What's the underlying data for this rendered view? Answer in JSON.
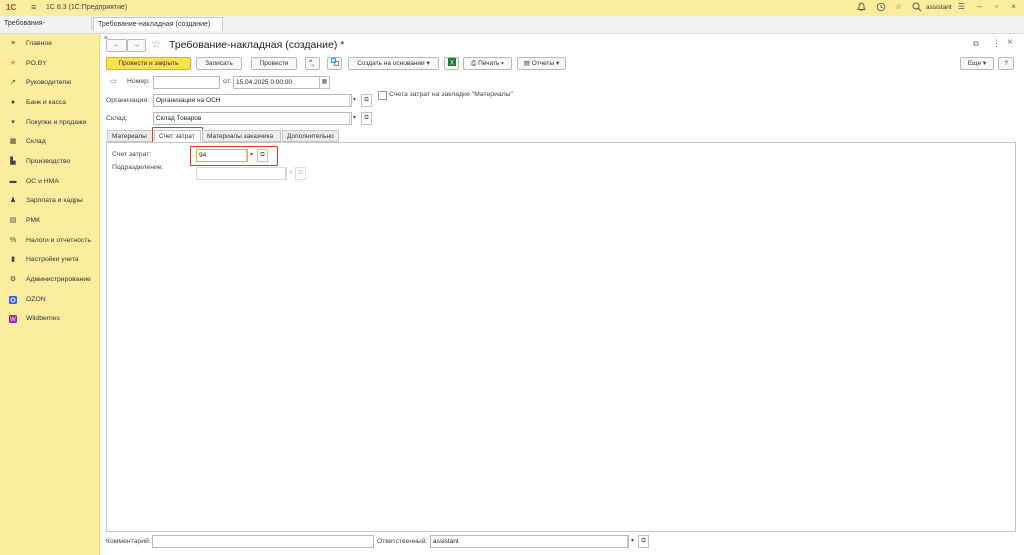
{
  "titlebar": {
    "logo": "1С",
    "app_title": "1С 8.3  (1С:Предприятие)",
    "user": "assistant",
    "menu_icon": "hamburger-icon",
    "icons": [
      "bell-icon",
      "history-icon",
      "star-icon",
      "search-icon",
      "settings-lines-icon",
      "minimize-icon",
      "restore-icon",
      "close-icon"
    ]
  },
  "tabs": [
    {
      "label": "Требования-накладные",
      "close": "×"
    },
    {
      "label": "Требование-накладная (создание) *",
      "close": "×"
    }
  ],
  "sidebar": {
    "items": [
      {
        "label": "Главное",
        "icon": "menu-lines-icon"
      },
      {
        "label": "PO.BY",
        "icon": "sun-icon"
      },
      {
        "label": "Руководителю",
        "icon": "trend-icon"
      },
      {
        "label": "Банк и касса",
        "icon": "bank-icon"
      },
      {
        "label": "Покупки и продажи",
        "icon": "cart-icon"
      },
      {
        "label": "Склад",
        "icon": "warehouse-icon"
      },
      {
        "label": "Производство",
        "icon": "factory-icon"
      },
      {
        "label": "ОС и НМА",
        "icon": "car-icon"
      },
      {
        "label": "Зарплата и кадры",
        "icon": "person-icon"
      },
      {
        "label": "РМК",
        "icon": "register-icon"
      },
      {
        "label": "Налоги и отчетность",
        "icon": "tax-icon"
      },
      {
        "label": "Настройки учета",
        "icon": "book-icon"
      },
      {
        "label": "Администрирование",
        "icon": "gear-icon"
      },
      {
        "label": "OZON",
        "icon": "ozon-icon"
      },
      {
        "label": "Wildberries",
        "icon": "wildberries-icon"
      }
    ]
  },
  "form": {
    "title": "Требование-накладная (создание) *",
    "nav_back": "←",
    "nav_forward": "→",
    "star": "☆",
    "link_icon": "⧉",
    "more_icon": "⋮",
    "close_icon": "×",
    "toolbar": {
      "post_close": "Провести и закрыть",
      "save": "Записать",
      "post": "Провести",
      "create_based": "Создать на основании",
      "print": "Печать",
      "reports": "Отчеты",
      "more": "Еще",
      "help": "?"
    },
    "number_label": "Номер:",
    "number_value": "",
    "date_label": "от:",
    "date_value": "15.04.2025  0:00:00",
    "org_label": "Организация:",
    "org_value": "Организация на ОСН",
    "warehouse_label": "Склад:",
    "warehouse_value": "Склад Товаров",
    "cost_checkbox_label": "Счета затрат на закладке \"Материалы\"",
    "cost_checkbox_checked": false,
    "inner_tabs": [
      "Материалы",
      "Счет затрат",
      "Материалы заказчика",
      "Дополнительно"
    ],
    "active_inner_tab": "Счет затрат",
    "cost_account_label": "Счет затрат:",
    "cost_account_value": "94",
    "division_label": "Подразделение:",
    "division_value": "",
    "comment_label": "Комментарий:",
    "comment_value": "",
    "responsible_label": "Ответственный:",
    "responsible_value": "assistant"
  }
}
